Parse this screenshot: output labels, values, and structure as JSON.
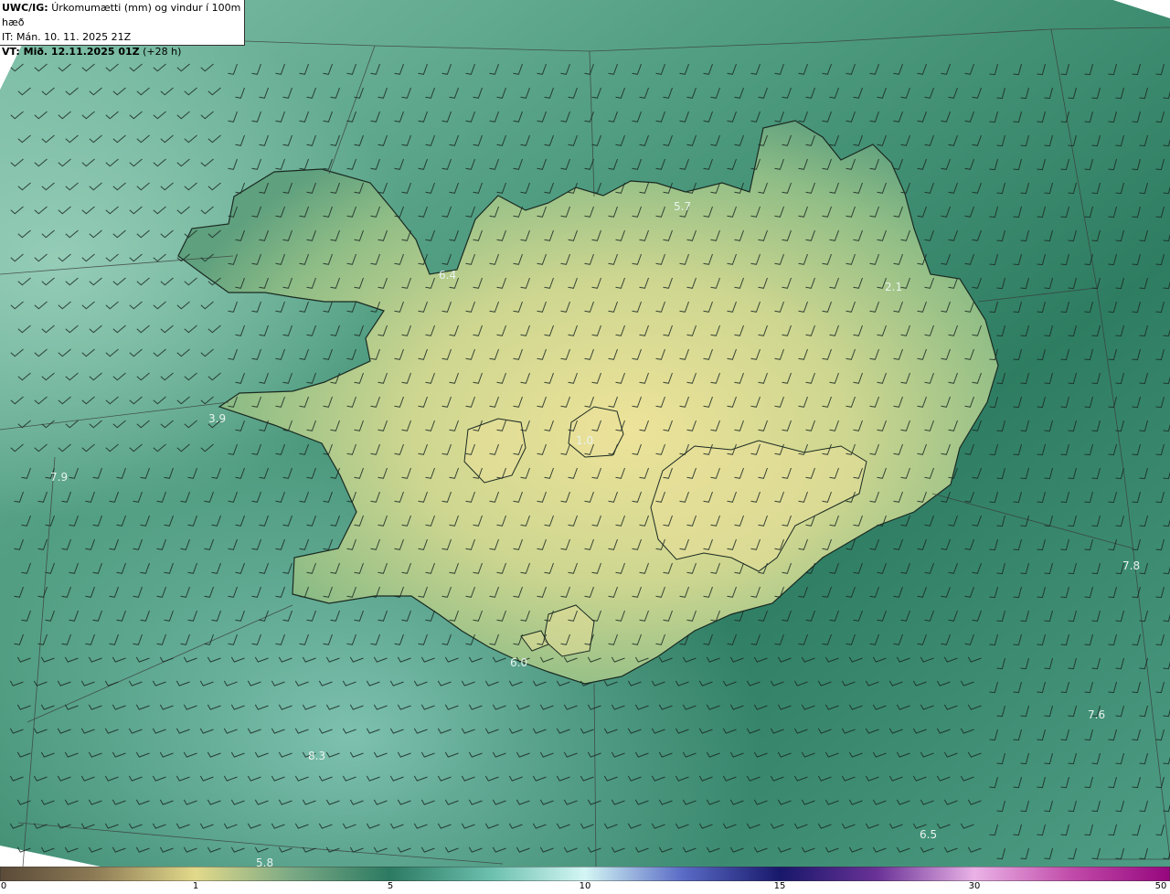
{
  "header": {
    "model_prefix": "UWC/IG:",
    "title": "Úrkomumætti (mm) og vindur í 100m hæð",
    "init_time": "IT: Mán. 10. 11. 2025 21Z",
    "valid_prefix": "VT: Mið. 12.11.2025 01Z",
    "lead": "(+28 h)"
  },
  "map_labels": [
    "5.7",
    "6.4",
    "2.1",
    "3.9",
    "1.0",
    "7.9",
    "7.8",
    "6.0",
    "7.6",
    "8.3",
    "6.5",
    "5.8"
  ],
  "colorbar": {
    "ticks": [
      "0",
      "1",
      "5",
      "10",
      "15",
      "30",
      "50"
    ],
    "colors": [
      "#6b5a3e",
      "#a89a6a",
      "#e8e28f",
      "#5e9a7a",
      "#2f7a63",
      "#6fc3b0",
      "#c9f2f0",
      "#3d4fa8",
      "#1a1870",
      "#5b2c8a",
      "#e4a3e0",
      "#a0108a"
    ]
  },
  "colors": {
    "land_high": "#e6dd8f",
    "land_mid": "#a8c384",
    "sea_dark": "#2f7d62",
    "sea_light": "#86c4ae",
    "coast": "#1a2a22"
  }
}
